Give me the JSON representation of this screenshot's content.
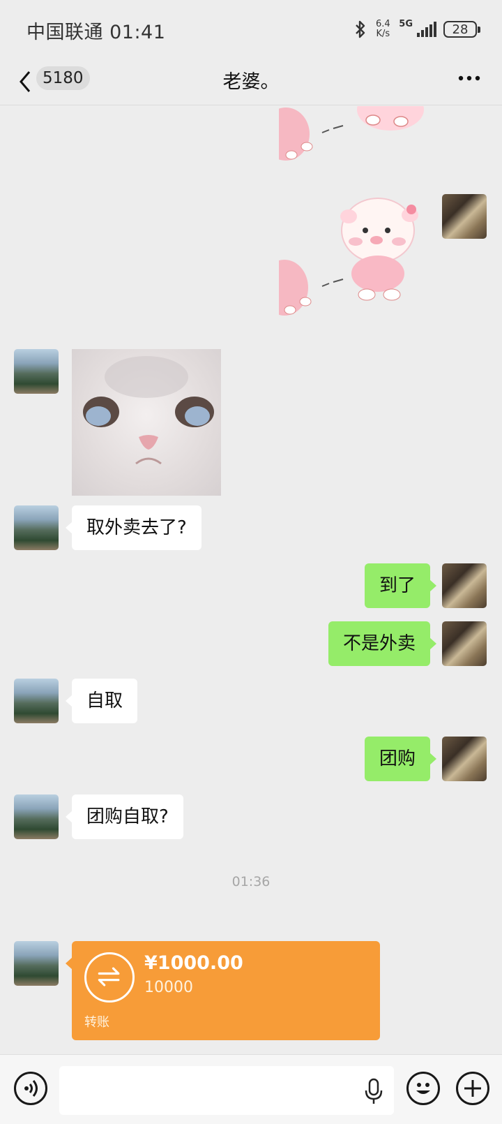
{
  "status_bar": {
    "carrier_time": "中国联通 01:41",
    "net_speed_top": "6.4",
    "net_speed_unit": "K/s",
    "network": "5G",
    "battery": "28"
  },
  "nav": {
    "unread_count": "5180",
    "title": "老婆。"
  },
  "messages": [
    {
      "side": "left",
      "text": "取外卖去了?"
    },
    {
      "side": "right",
      "text": "到了"
    },
    {
      "side": "right",
      "text": "不是外卖"
    },
    {
      "side": "left",
      "text": "自取"
    },
    {
      "side": "right",
      "text": "团购"
    },
    {
      "side": "left",
      "text": "团购自取?"
    }
  ],
  "timestamp": "01:36",
  "transfer": {
    "amount": "¥1000.00",
    "note": "10000",
    "label": "转账"
  },
  "colors": {
    "background": "#ededed",
    "self_bubble": "#95ec69",
    "other_bubble": "#ffffff",
    "transfer": "#f79c38"
  },
  "icons": {
    "voice": "voice-toggle-icon",
    "mic": "microphone-icon",
    "emoji": "emoji-icon",
    "plus": "plus-icon",
    "back": "back-chevron-icon",
    "more": "more-dots-icon"
  }
}
